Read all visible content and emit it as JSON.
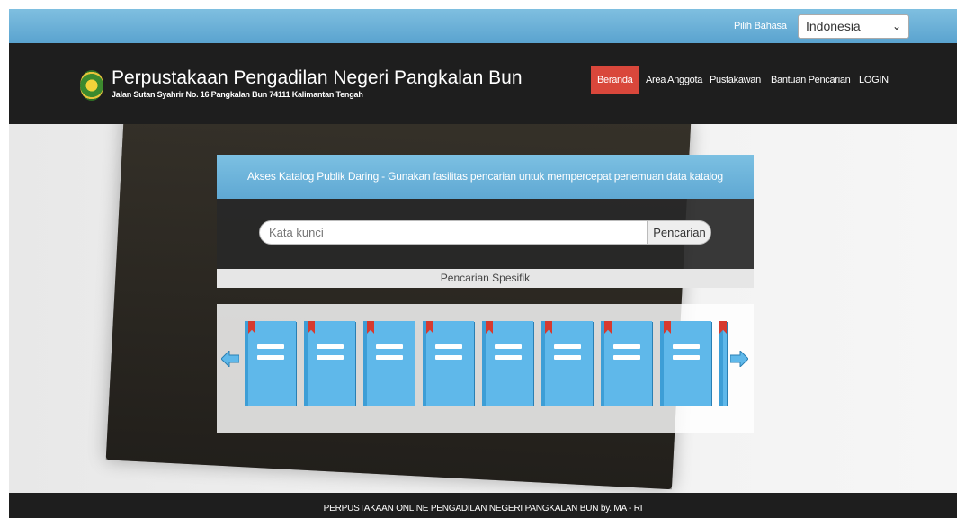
{
  "language_bar": {
    "label": "Pilih Bahasa",
    "selected_language": "Indonesia"
  },
  "header": {
    "title": "Perpustakaan Pengadilan Negeri Pangkalan Bun",
    "address": "Jalan Sutan Syahrir No. 16 Pangkalan Bun 74111 Kalimantan Tengah",
    "logo_icon": "court-emblem-icon"
  },
  "nav": {
    "items": [
      {
        "label": "Beranda",
        "active": true
      },
      {
        "label": "Area Anggota",
        "active": false
      },
      {
        "label": "Pustakawan",
        "active": false
      },
      {
        "label": "Bantuan Pencarian",
        "active": false
      },
      {
        "label": "LOGIN",
        "active": false
      }
    ]
  },
  "catalog": {
    "heading": "Akses Katalog Publik Daring - Gunakan fasilitas pencarian untuk mempercepat penemuan data katalog",
    "search_placeholder": "Kata kunci",
    "search_button": "Pencarian",
    "specific_search": "Pencarian Spesifik"
  },
  "carousel": {
    "prev_icon": "arrow-left-icon",
    "next_icon": "arrow-right-icon",
    "book_icon": "book-icon"
  },
  "footer": {
    "text": "PERPUSTAKAAN ONLINE PENGADILAN NEGERI PANGKALAN BUN by. MA - RI"
  },
  "colors": {
    "accent_blue": "#5fa8d3",
    "active_nav": "#d9473b",
    "dark_bar": "#1e1e1e"
  }
}
